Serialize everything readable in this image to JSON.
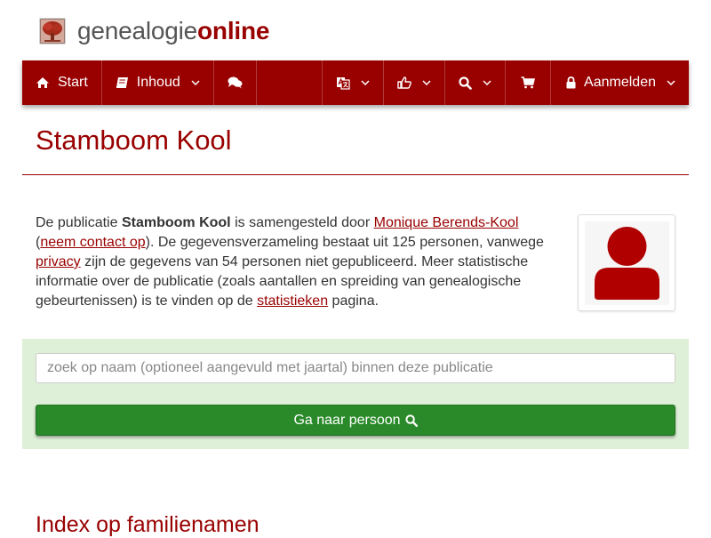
{
  "site": {
    "name_part1": "genealogie",
    "name_part2": "online"
  },
  "nav": {
    "start": "Start",
    "inhoud": "Inhoud",
    "aanmelden": "Aanmelden"
  },
  "page": {
    "title": "Stamboom Kool"
  },
  "intro": {
    "t1": "De publicatie ",
    "pub_name": "Stamboom Kool",
    "t2": " is samengesteld door ",
    "author_link": "Monique Berends-Kool",
    "t3": " (",
    "contact_link": "neem contact op",
    "t4": "). De gegevensverzameling bestaat uit 125 personen, vanwege ",
    "privacy_link": "privacy",
    "t5": " zijn de gegevens van 54 personen niet gepubliceerd. Meer statistische informatie over de publicatie (zoals aantallen en spreiding van genealogische gebeurtenissen) is te vinden op de ",
    "stats_link": "statistieken",
    "t6": " pagina."
  },
  "search": {
    "placeholder": "zoek op naam (optioneel aangevuld met jaartal) binnen deze publicatie",
    "value": "",
    "button_label": "Ga naar persoon"
  },
  "section": {
    "heading": "Index op familienamen"
  },
  "colors": {
    "brand": "#990000",
    "panel": "#dff0d8",
    "button": "#2a8a2a"
  },
  "icons": [
    "tree-logo-icon",
    "home-icon",
    "book-icon",
    "comments-icon",
    "translate-icon",
    "thumbs-up-icon",
    "search-icon",
    "shopping-cart-icon",
    "lock-icon",
    "chevron-down-icon",
    "user-silhouette-icon"
  ]
}
